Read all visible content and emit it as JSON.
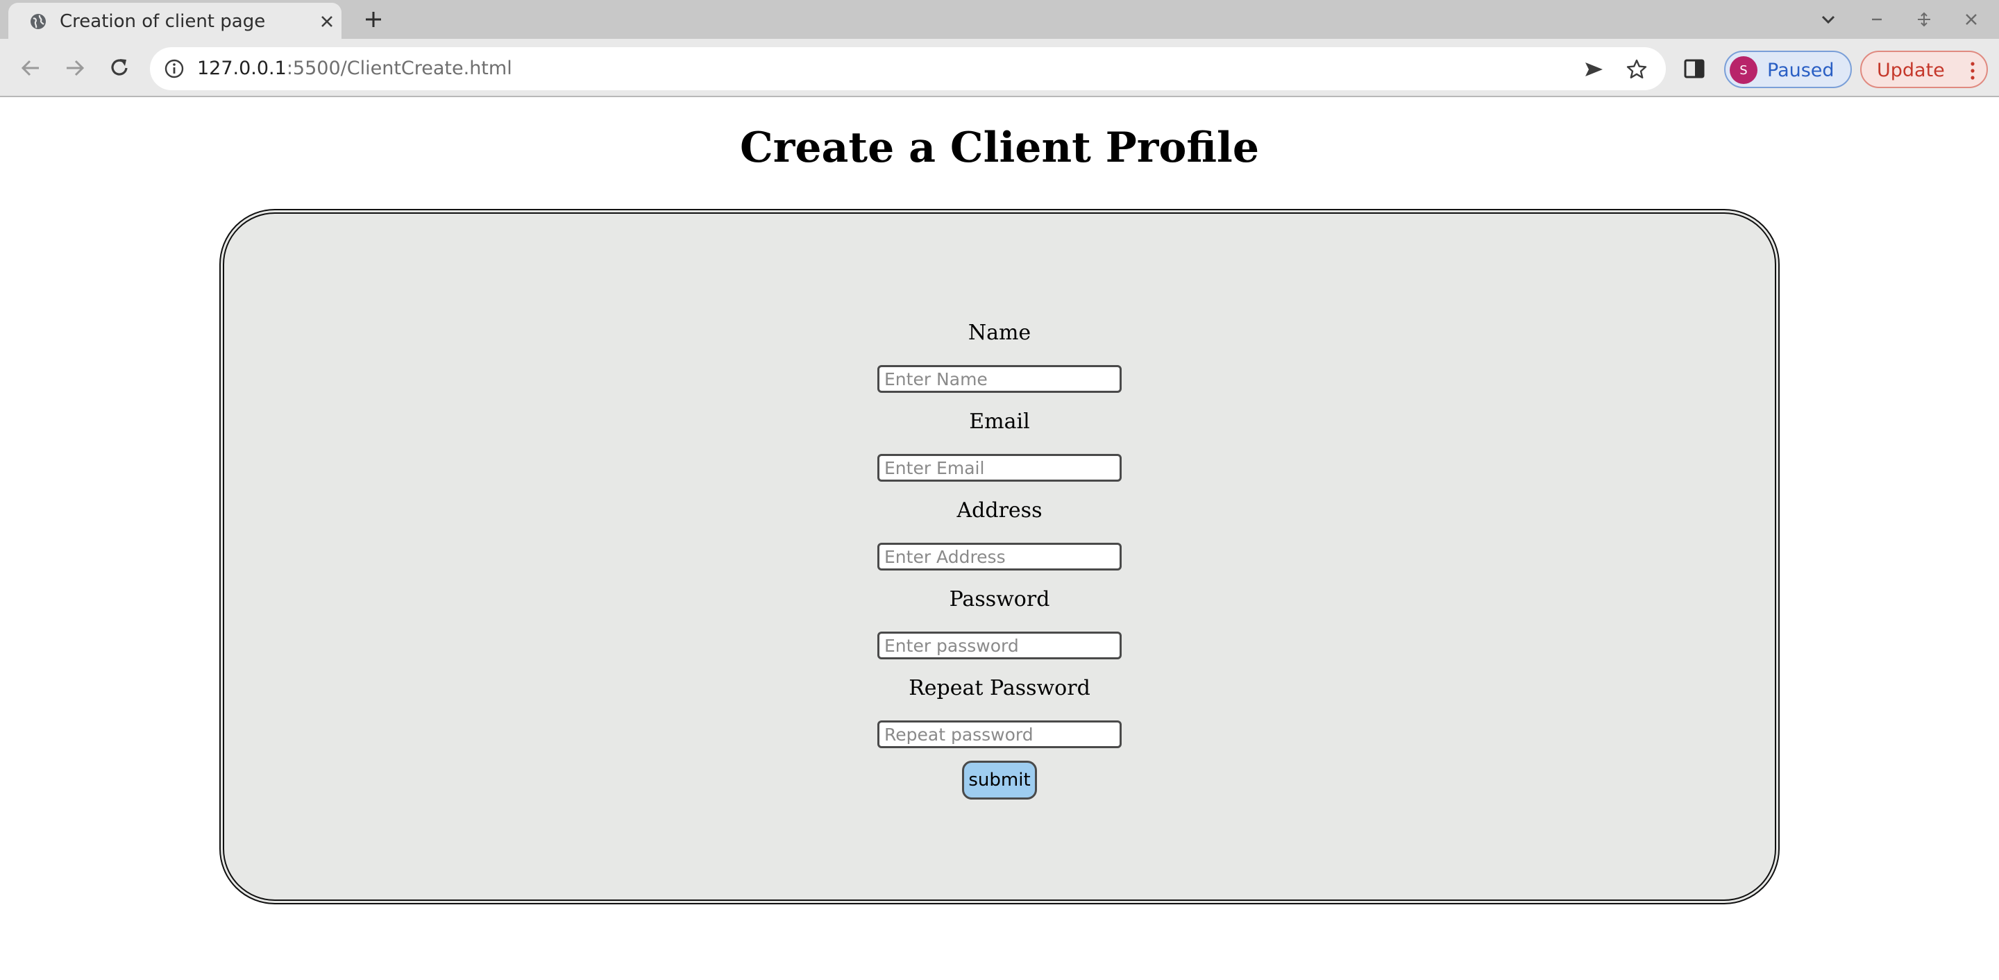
{
  "browser": {
    "tab_title": "Creation of client page",
    "url_host": "127.0.0.1",
    "url_rest": ":5500/ClientCreate.html",
    "profile_initial": "S",
    "profile_status": "Paused",
    "update_label": "Update",
    "icons": [
      "globe-icon",
      "close-icon",
      "plus-icon",
      "chevron-down-icon",
      "minimize-icon",
      "maximize-icon",
      "window-close-icon",
      "back-arrow-icon",
      "forward-arrow-icon",
      "reload-icon",
      "info-icon",
      "send-icon",
      "star-icon",
      "side-panel-icon",
      "kebab-menu-icon"
    ],
    "colors": {
      "profile_accent": "#2a5fc4",
      "avatar_bg": "#b8246a",
      "update_accent": "#c5382b"
    }
  },
  "page": {
    "title": "Create a Client Profile",
    "card_background": "#e7e8e6",
    "fields": [
      {
        "label": "Name",
        "placeholder": "Enter Name",
        "type": "text"
      },
      {
        "label": "Email",
        "placeholder": "Enter Email",
        "type": "email"
      },
      {
        "label": "Address",
        "placeholder": "Enter Address",
        "type": "text"
      },
      {
        "label": "Password",
        "placeholder": "Enter password",
        "type": "password"
      },
      {
        "label": "Repeat Password",
        "placeholder": "Repeat password",
        "type": "password"
      }
    ],
    "submit_label": "submit",
    "submit_color": "#9ecdf0"
  }
}
